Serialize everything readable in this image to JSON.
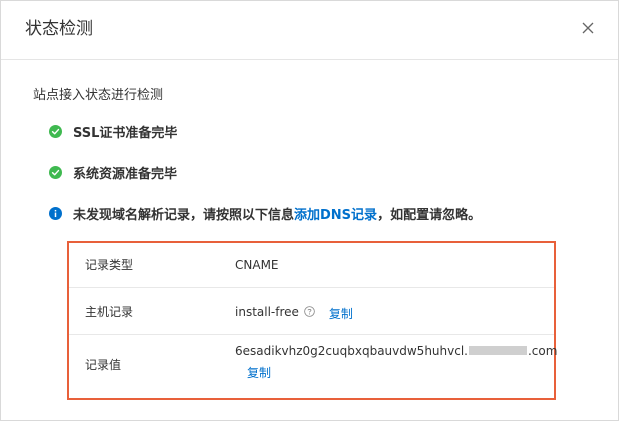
{
  "dialog": {
    "title": "状态检测",
    "close_icon": "close-icon"
  },
  "intro": "站点接入状态进行检测",
  "status": {
    "ssl": "SSL证书准备完毕",
    "system": "系统资源准备完毕",
    "dns_prefix": "未发现域名解析记录，请按照以下信息",
    "dns_link": "添加DNS记录",
    "dns_suffix": "，如配置请忽略。"
  },
  "record": {
    "type_label": "记录类型",
    "type_value": "CNAME",
    "host_label": "主机记录",
    "host_value": "install-free",
    "host_copy": "复制",
    "value_label": "记录值",
    "value_prefix": "6esadikvhz0g2cuqbxqbauvdw5huhvcl.",
    "value_suffix": ".com",
    "value_copy": "复制"
  },
  "colors": {
    "success": "#3fb950",
    "info": "#0070cc",
    "highlight_border": "#e8603a",
    "link": "#0070cc"
  }
}
